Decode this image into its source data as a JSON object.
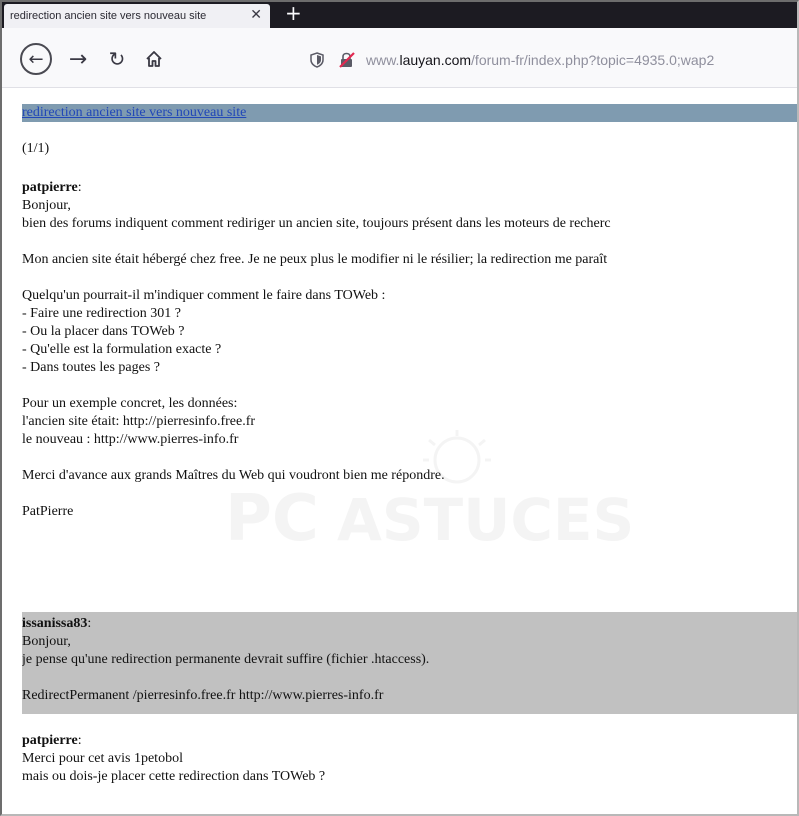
{
  "browser": {
    "tab_title": "redirection ancien site vers nouveau site",
    "url_domain_prefix": "www.",
    "url_domain": "lauyan.com",
    "url_path": "/forum-fr/index.php?topic=4935.0;wap2",
    "icons": {
      "close": "close-icon",
      "new_tab": "plus-icon",
      "back": "back-arrow-icon",
      "forward": "forward-arrow-icon",
      "reload": "reload-icon",
      "home": "home-icon",
      "shield": "shield-icon",
      "insecure": "insecure-lock-icon"
    }
  },
  "page": {
    "title": "redirection ancien site vers nouveau site",
    "page_count": "(1/1)",
    "posts": [
      {
        "author": "patpierre",
        "lines": [
          "Bonjour,",
          "bien des forums indiquent comment rediriger un ancien site, toujours présent dans les moteurs de recherc",
          "",
          "Mon ancien site était hébergé chez free. Je ne peux plus le modifier ni le résilier; la redirection me paraît",
          "",
          "Quelqu'un pourrait-il m'indiquer comment le faire dans TOWeb :",
          "- Faire une redirection 301 ?",
          "- Ou la placer dans TOWeb ?",
          "- Qu'elle est la formulation exacte ?",
          "- Dans toutes les pages ?",
          "",
          "Pour un exemple concret, les données:",
          "l'ancien site était: http://pierresinfo.free.fr",
          "le nouveau : http://www.pierres-info.fr",
          "",
          "Merci d'avance aux grands Maîtres du Web qui voudront bien me répondre.",
          "",
          "PatPierre"
        ]
      },
      {
        "author": "issanissa83",
        "lines": [
          "Bonjour,",
          "je pense qu'une redirection permanente devrait suffire (fichier .htaccess).",
          "",
          "RedirectPermanent /pierresinfo.free.fr  http://www.pierres-info.fr"
        ]
      },
      {
        "author": "patpierre",
        "lines": [
          "Merci pour cet avis 1petobol",
          "mais ou dois-je placer cette redirection dans TOWeb ?"
        ]
      }
    ]
  },
  "watermark": {
    "brand_left": "PC",
    "brand_right": "ASTUCES"
  },
  "colors": {
    "tabstrip": "#1c1b22",
    "tab": "#f0f0f4",
    "navbar": "#f9f9fb",
    "title_bar": "#7f9bb0",
    "link": "#2147b8",
    "reply_bg": "#c1c1c1"
  }
}
